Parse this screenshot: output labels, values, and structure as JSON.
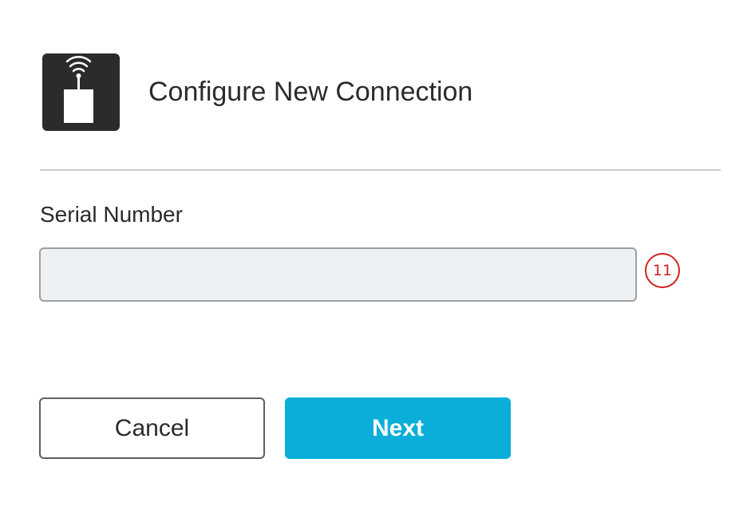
{
  "header": {
    "icon": "wireless-device-icon",
    "title": "Configure New Connection"
  },
  "form": {
    "serial_label": "Serial Number",
    "serial_value": "",
    "serial_placeholder": ""
  },
  "annotation": {
    "marker": "11",
    "color": "#d12020"
  },
  "actions": {
    "cancel_label": "Cancel",
    "next_label": "Next",
    "next_color": "#0aaed8"
  }
}
